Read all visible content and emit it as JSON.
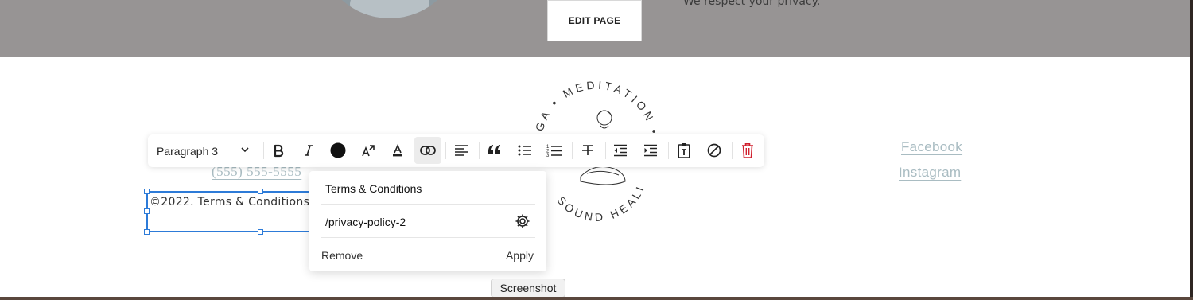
{
  "header": {
    "edit_page_label": "EDIT PAGE",
    "privacy_text": "We respect your privacy."
  },
  "logo": {
    "ring_text_top": "YOGA • MEDITATION •",
    "ring_text_bottom": "SOUND HEALING"
  },
  "footer": {
    "phone": "(555) 555-5555",
    "copyright_text": "©2022. Terms & Conditions | Privacy Policy",
    "social_links": [
      "Facebook",
      "Instagram"
    ]
  },
  "toolbar": {
    "paragraph_style": "Paragraph 3",
    "buttons": [
      "bold-icon",
      "italic-icon",
      "text-color-icon",
      "text-size-icon",
      "highlight-icon",
      "link-icon",
      "align-left-icon",
      "quote-icon",
      "bullet-list-icon",
      "numbered-list-icon",
      "strikethrough-icon",
      "outdent-icon",
      "indent-icon",
      "paste-plain-text-icon",
      "clear-format-icon",
      "delete-icon"
    ]
  },
  "link_popover": {
    "title": "Terms & Conditions",
    "url": "/privacy-policy-2",
    "remove_label": "Remove",
    "apply_label": "Apply"
  },
  "tooltip": {
    "label": "Screenshot"
  },
  "colors": {
    "header_band": "#979494",
    "selection_blue": "#2d7bd8",
    "social_link": "#a9bcc2",
    "delete_red": "#d0202e"
  }
}
